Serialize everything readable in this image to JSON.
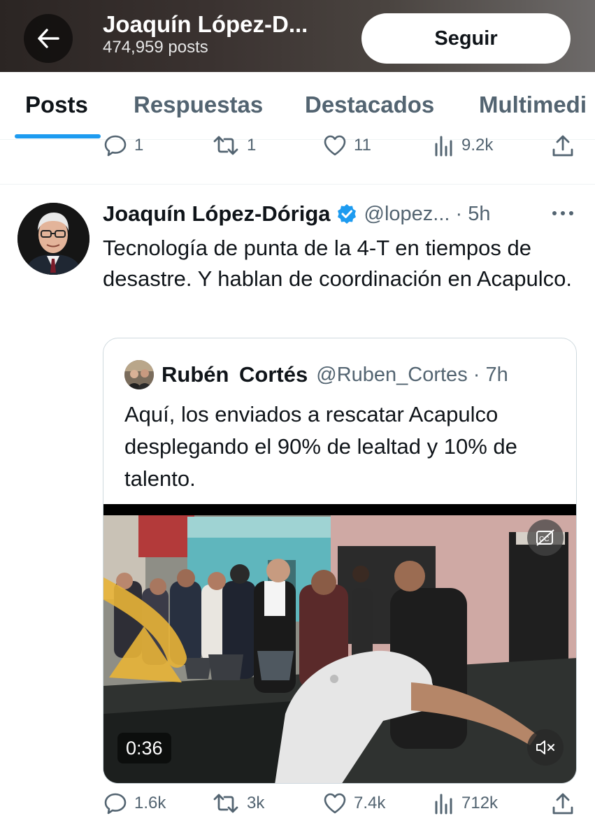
{
  "header": {
    "profile_name": "Joaquín López-D...",
    "posts_count": "474,959 posts",
    "follow_label": "Seguir"
  },
  "tabs": [
    {
      "label": "Posts",
      "active": true
    },
    {
      "label": "Respuestas",
      "active": false
    },
    {
      "label": "Destacados",
      "active": false
    },
    {
      "label": "Multimedi",
      "active": false
    }
  ],
  "previous_post_actions": {
    "replies": "1",
    "reposts": "1",
    "likes": "11",
    "views": "9.2k"
  },
  "tweet": {
    "author_name": "Joaquín López-Dóriga",
    "handle_time": "@lopez... · 5h",
    "text": "Tecnología de punta de la 4-T en tiempos de desastre. Y hablan de coordinación en Acapulco.",
    "quote": {
      "author_name": "Rubén  Cortés",
      "handle_time": "@Ruben_Cortes · 7h",
      "text": "Aquí, los enviados a rescatar Acapulco desplegando el 90% de lealtad y 10% de talento.",
      "video_duration": "0:36"
    },
    "actions": {
      "replies": "1.6k",
      "reposts": "3k",
      "likes": "7.4k",
      "views": "712k"
    }
  },
  "colors": {
    "accent": "#1d9bf0",
    "text_secondary": "#536471",
    "annotation_arrow": "#e8b437"
  },
  "icons": [
    "back-arrow-icon",
    "reply-icon",
    "repost-icon",
    "like-icon",
    "views-icon",
    "share-icon",
    "verified-badge-icon",
    "more-icon",
    "captions-icon",
    "mute-icon"
  ]
}
